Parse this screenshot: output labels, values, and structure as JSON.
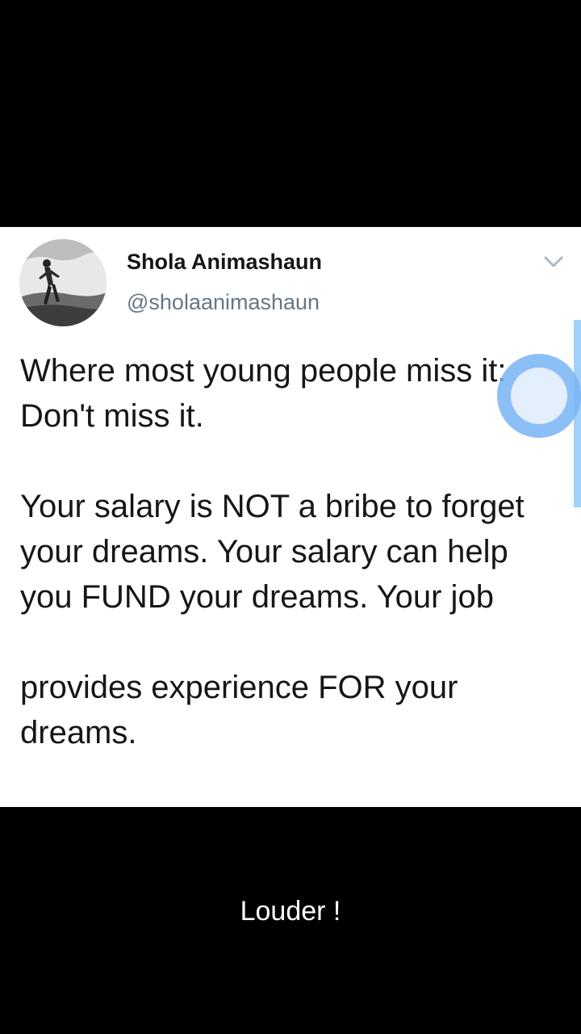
{
  "tweet": {
    "author": {
      "display_name": "Shola Animashaun",
      "handle": "@sholaanimashaun",
      "avatar_icon": "profile-photo"
    },
    "menu_icon": "chevron-down-icon",
    "text": "Where most young people miss it: Don't miss it.\n\nYour salary is NOT a bribe to forget your dreams. Your salary can help you FUND your dreams. Your job\n\nprovides experience FOR your dreams."
  },
  "caption": "Louder !",
  "colors": {
    "background": "#000000",
    "card": "#ffffff",
    "name": "#14171a",
    "handle": "#657786",
    "accent": "#9fd1fb"
  }
}
